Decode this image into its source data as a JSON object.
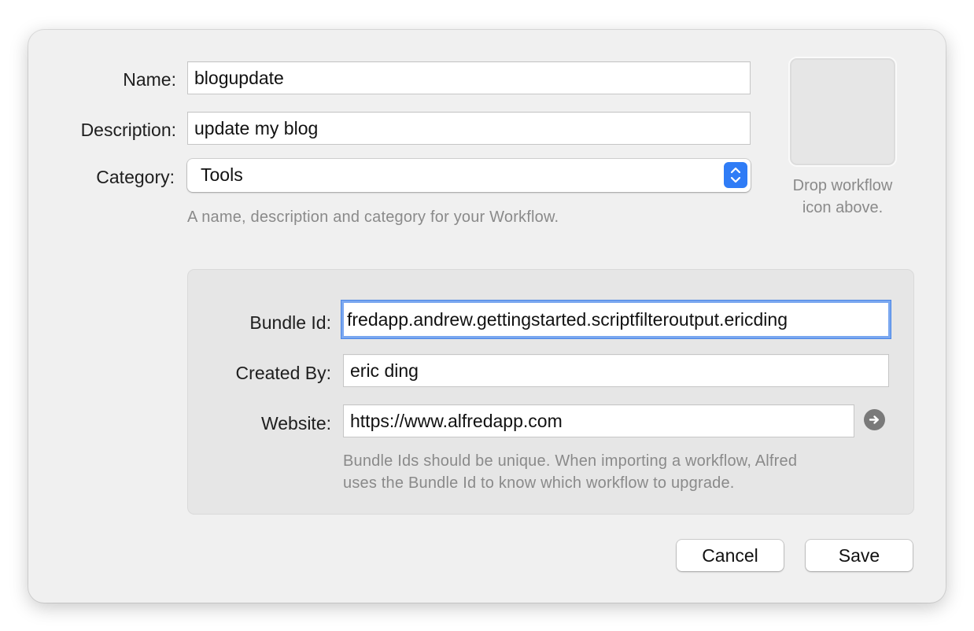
{
  "info": {
    "name_label": "Name:",
    "name_value": "blogupdate",
    "description_label": "Description:",
    "description_value": "update my blog",
    "category_label": "Category:",
    "category_value": "Tools",
    "help_text": "A name, description and category for your Workflow."
  },
  "icon_well": {
    "caption_line1": "Drop workflow",
    "caption_line2": "icon above."
  },
  "bundle": {
    "bundle_id_label": "Bundle Id:",
    "bundle_id_value": "fredapp.andrew.gettingstarted.scriptfilteroutput.ericding",
    "created_by_label": "Created By:",
    "created_by_value": "eric ding",
    "website_label": "Website:",
    "website_value": "https://www.alfredapp.com",
    "help_line1": "Bundle Ids should be unique. When importing a workflow, Alfred",
    "help_line2": "uses the Bundle Id to know which workflow to upgrade."
  },
  "buttons": {
    "cancel_label": "Cancel",
    "save_label": "Save"
  },
  "colors": {
    "accent": "#2f7cf6",
    "focus_ring": "#7aa7f0",
    "sheet_background": "#f0f0f0"
  },
  "icons": {
    "stepper": "chevron-up-down-icon",
    "go": "arrow-right-circle-icon"
  }
}
